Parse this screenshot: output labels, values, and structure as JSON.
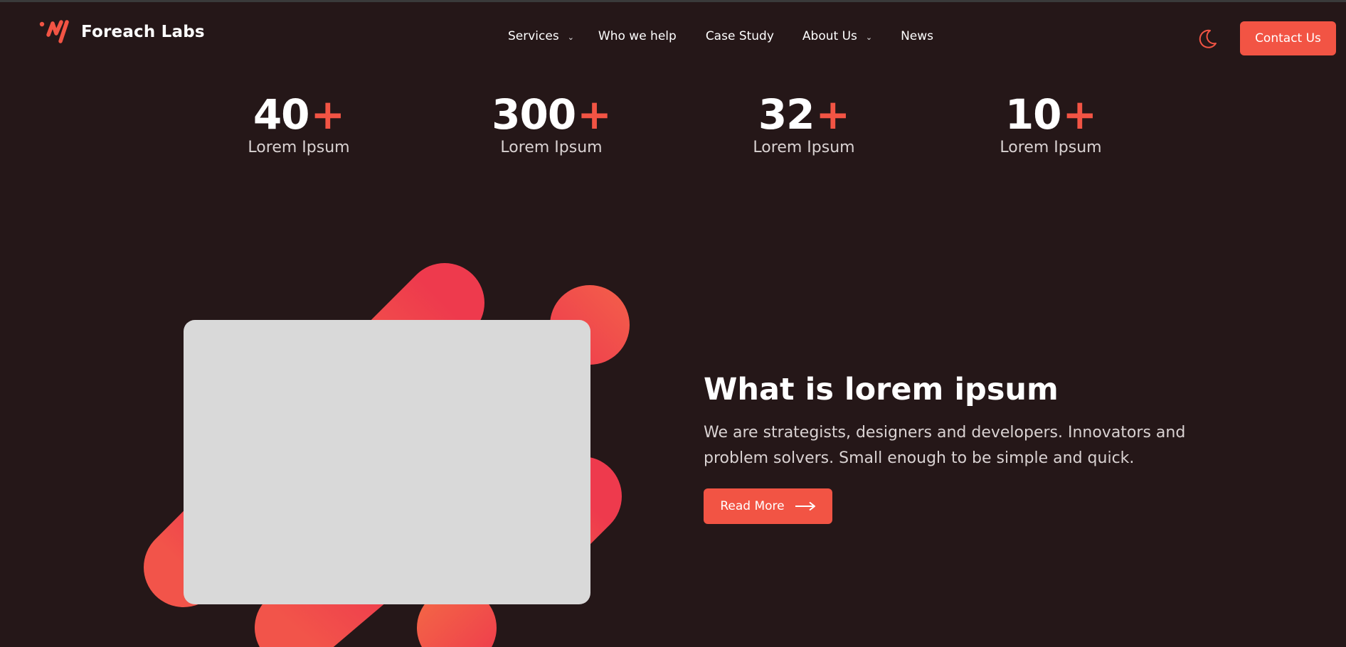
{
  "brand": {
    "name": "Foreach Labs",
    "accent_color": "#f25444",
    "background_color": "#251718"
  },
  "nav": {
    "items": [
      {
        "label": "Services",
        "has_dropdown": true
      },
      {
        "label": "Who we help",
        "has_dropdown": false
      },
      {
        "label": "Case Study",
        "has_dropdown": false
      },
      {
        "label": "About Us",
        "has_dropdown": true
      },
      {
        "label": "News",
        "has_dropdown": false
      }
    ],
    "dropdown_icon": "chevron-down-icon"
  },
  "header": {
    "theme_toggle_icon": "moon-icon",
    "contact_label": "Contact Us"
  },
  "stats": [
    {
      "value": "40",
      "suffix": "+",
      "label": "Lorem Ipsum"
    },
    {
      "value": "300",
      "suffix": "+",
      "label": "Lorem Ipsum"
    },
    {
      "value": "32",
      "suffix": "+",
      "label": "Lorem Ipsum"
    },
    {
      "value": "10",
      "suffix": "+",
      "label": "Lorem Ipsum"
    }
  ],
  "hero": {
    "title": "What is lorem ipsum",
    "description": "We are strategists, designers and developers. Innovators and problem solvers. Small enough to be simple and quick.",
    "cta_label": "Read More",
    "cta_icon": "arrow-right-icon"
  }
}
